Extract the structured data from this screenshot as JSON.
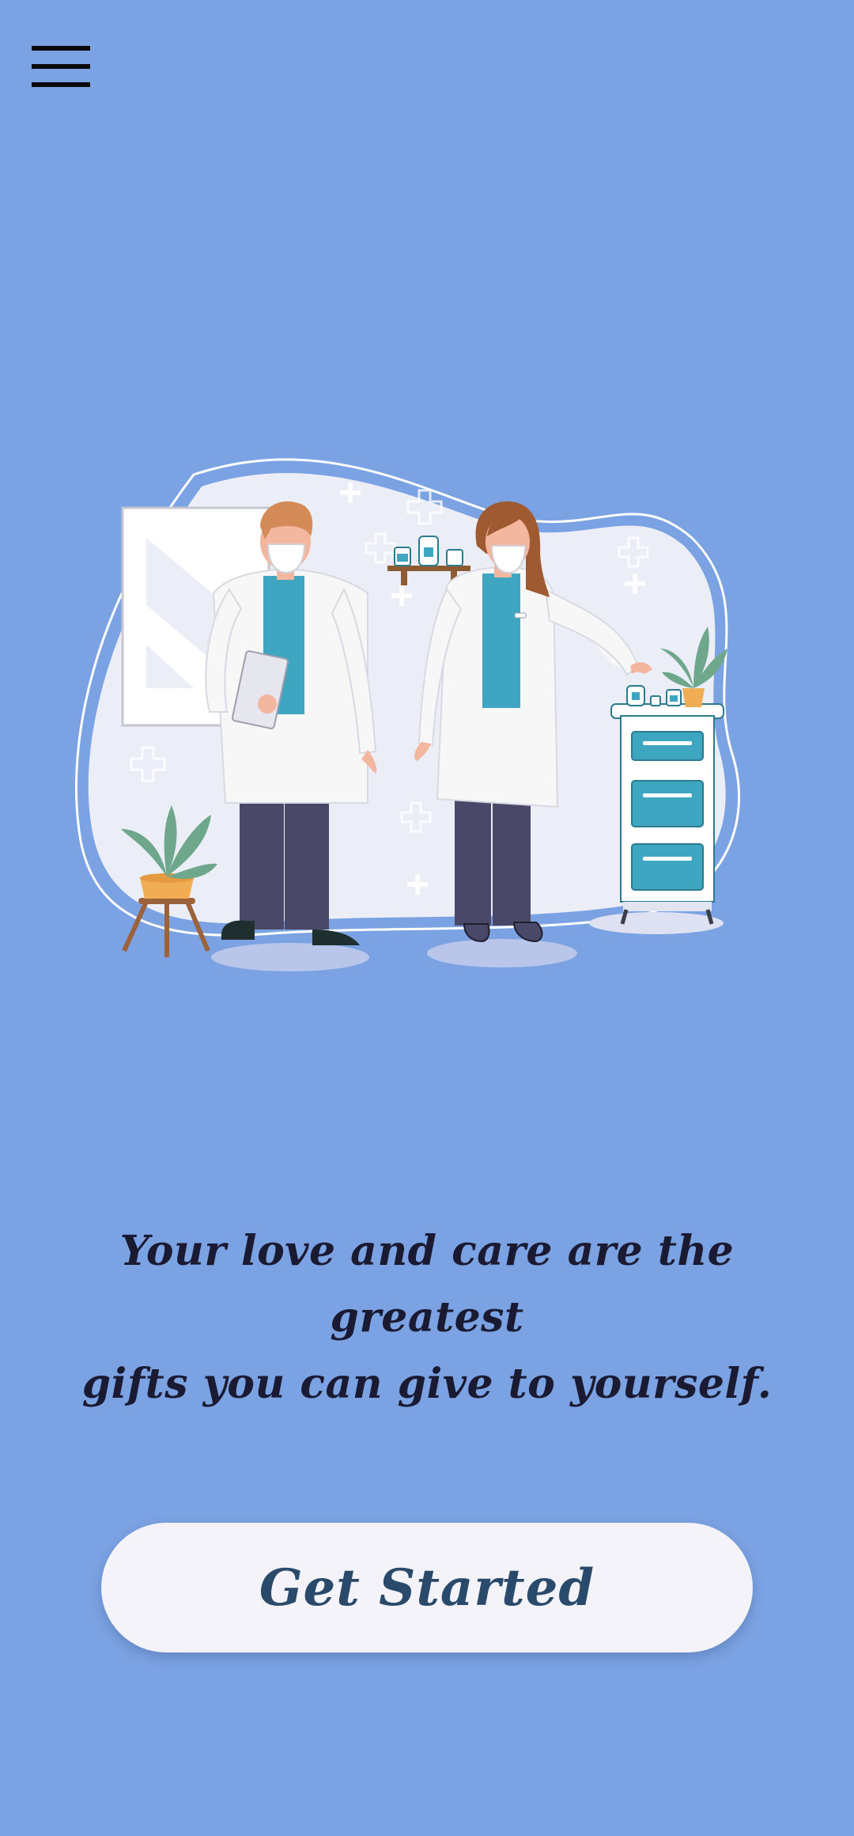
{
  "app": {
    "menu_icon": "hamburger-menu-icon"
  },
  "hero": {
    "illustration": "two-masked-pharmacists-illustration"
  },
  "tagline": {
    "line1": "Your love and care are the greatest",
    "line2": "gifts you can give to yourself."
  },
  "cta": {
    "label": "Get Started"
  },
  "colors": {
    "background": "#7ba2e2",
    "tagline_text": "#1b1a33",
    "button_bg": "#f4f3f9",
    "button_text": "#2a4a6b",
    "accent_teal": "#3fa6c2",
    "pants": "#4a4868"
  }
}
